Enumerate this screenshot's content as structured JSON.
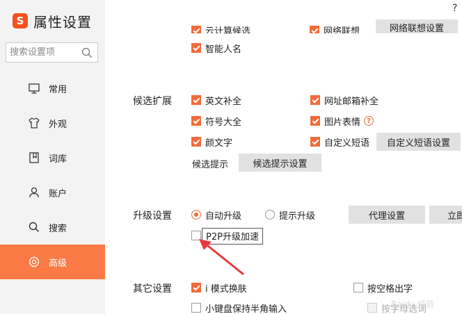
{
  "brand": {
    "title": "属性设置",
    "logo_letter": "S"
  },
  "search": {
    "placeholder": "搜索设置项"
  },
  "nav": [
    {
      "label": "常用",
      "icon": "monitor-icon"
    },
    {
      "label": "外观",
      "icon": "shirt-icon"
    },
    {
      "label": "词库",
      "icon": "book-icon"
    },
    {
      "label": "账户",
      "icon": "user-icon"
    },
    {
      "label": "搜索",
      "icon": "search-icon"
    },
    {
      "label": "高级",
      "icon": "gear-icon",
      "active": true
    }
  ],
  "help_symbol": "?",
  "top_partial": {
    "cloud": "云计算候选",
    "context": "网络联想",
    "context_button": "网络联想设置"
  },
  "smart_name": "智能人名",
  "candidate_ext": {
    "title": "候选扩展",
    "items": [
      {
        "label": "英文补全",
        "checked": true
      },
      {
        "label": "网址邮箱补全",
        "checked": true
      },
      {
        "label": "符号大全",
        "checked": true
      },
      {
        "label": "图片表情",
        "checked": true
      },
      {
        "label": "颜文字",
        "checked": true
      },
      {
        "label": "自定义短语",
        "checked": true
      }
    ],
    "custom_phrase_button": "自定义短语设置",
    "hint_label": "候选提示",
    "hint_button": "候选提示设置"
  },
  "upgrade": {
    "title": "升级设置",
    "auto": "自动升级",
    "prompt": "提示升级",
    "proxy_button": "代理设置",
    "now_button": "立即",
    "p2p": "P2P升级加速"
  },
  "other": {
    "title": "其它设置",
    "i_mode": "i 模式换肤",
    "keyboard": "小键盘保持半角输入",
    "right_top": "按空格出字",
    "right_bottom": "按字母选词"
  },
  "watermark": "Baidu 经验",
  "colors": {
    "accent": "#f26b3a",
    "sidebar_active": "#fb7a45",
    "sidebar_bg": "#f3f3f3",
    "annotation": "#e8383d"
  }
}
